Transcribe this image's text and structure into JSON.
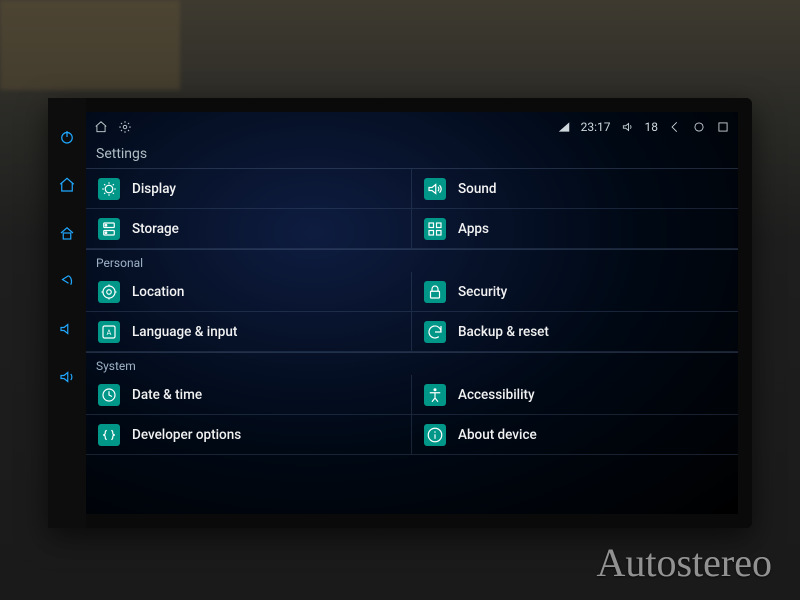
{
  "statusbar": {
    "time": "23:17",
    "volume": "18"
  },
  "screen_title": "Settings",
  "sections": {
    "device_header": "",
    "personal_header": "Personal",
    "system_header": "System"
  },
  "items": {
    "display": "Display",
    "sound": "Sound",
    "storage": "Storage",
    "apps": "Apps",
    "location": "Location",
    "security": "Security",
    "language": "Language & input",
    "backup": "Backup & reset",
    "datetime": "Date & time",
    "accessibility": "Accessibility",
    "developer": "Developer options",
    "about": "About device"
  },
  "watermark": "Autostereo"
}
